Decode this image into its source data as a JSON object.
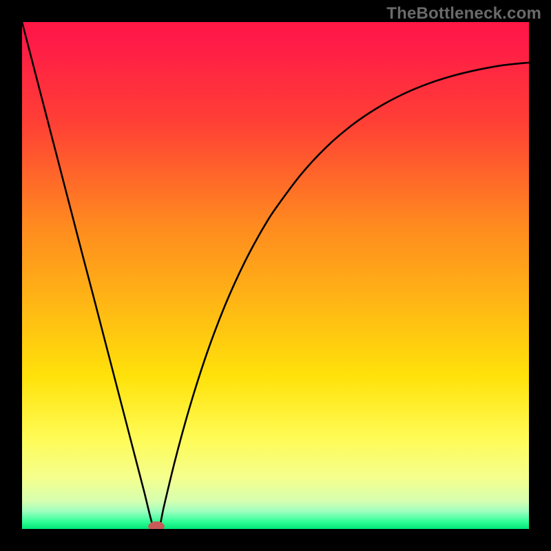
{
  "watermark": "TheBottleneck.com",
  "chart_data": {
    "type": "line",
    "title": "",
    "xlabel": "",
    "ylabel": "",
    "xlim": [
      0,
      100
    ],
    "ylim": [
      0,
      100
    ],
    "grid": false,
    "legend": false,
    "gradient_stops": [
      {
        "offset": 0.0,
        "color": "#ff1744"
      },
      {
        "offset": 0.03,
        "color": "#ff1948"
      },
      {
        "offset": 0.2,
        "color": "#ff4035"
      },
      {
        "offset": 0.4,
        "color": "#ff8a1f"
      },
      {
        "offset": 0.55,
        "color": "#ffb515"
      },
      {
        "offset": 0.7,
        "color": "#ffe20a"
      },
      {
        "offset": 0.82,
        "color": "#fffb55"
      },
      {
        "offset": 0.9,
        "color": "#f4ff8e"
      },
      {
        "offset": 0.945,
        "color": "#d6ffb0"
      },
      {
        "offset": 0.965,
        "color": "#9effbf"
      },
      {
        "offset": 0.985,
        "color": "#33ff99"
      },
      {
        "offset": 1.0,
        "color": "#00e676"
      }
    ],
    "series": [
      {
        "name": "curve",
        "stroke": "#000000",
        "stroke_width": 2.6,
        "x": [
          0,
          2,
          4,
          6,
          8,
          10,
          12,
          14,
          16,
          18,
          20,
          22,
          24,
          26,
          27,
          28,
          30,
          32,
          34,
          36,
          38,
          40,
          42,
          44,
          46,
          48,
          50,
          55,
          60,
          65,
          70,
          75,
          80,
          85,
          90,
          95,
          100
        ],
        "y": [
          100.0,
          92.3,
          84.6,
          76.9,
          69.2,
          61.5,
          53.8,
          46.2,
          38.5,
          30.8,
          23.1,
          15.4,
          7.7,
          0.0,
          0.0,
          4.5,
          12.8,
          20.3,
          27.1,
          33.3,
          38.9,
          44.0,
          48.6,
          52.8,
          56.6,
          60.1,
          63.2,
          69.9,
          75.3,
          79.6,
          83.0,
          85.7,
          87.8,
          89.4,
          90.6,
          91.5,
          92.0
        ]
      }
    ],
    "marker": {
      "name": "min-point",
      "x": 26.5,
      "y": 0.5,
      "rx": 1.6,
      "ry": 1.0,
      "fill": "#c95a5a"
    }
  }
}
